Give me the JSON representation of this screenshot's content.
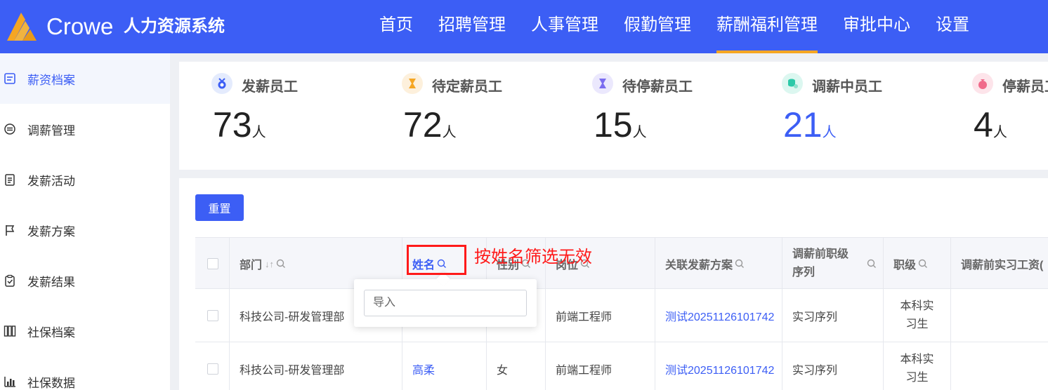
{
  "header": {
    "brand": "Crowe",
    "system_name": "人力资源系统",
    "nav": [
      {
        "label": "首页"
      },
      {
        "label": "招聘管理"
      },
      {
        "label": "人事管理"
      },
      {
        "label": "假勤管理"
      },
      {
        "label": "薪酬福利管理",
        "active": true
      },
      {
        "label": "审批中心"
      },
      {
        "label": "设置"
      }
    ],
    "accent_color": "#f5a623",
    "bg_color": "#3c5ef5"
  },
  "sidebar": {
    "items": [
      {
        "label": "薪资档案",
        "icon": "file-icon",
        "active": true
      },
      {
        "label": "调薪管理",
        "icon": "exchange-icon"
      },
      {
        "label": "发薪活动",
        "icon": "clipboard-icon"
      },
      {
        "label": "发薪方案",
        "icon": "flag-icon"
      },
      {
        "label": "发薪结果",
        "icon": "check-clipboard-icon"
      },
      {
        "label": "社保档案",
        "icon": "archive-icon"
      },
      {
        "label": "社保数据",
        "icon": "bar-chart-icon"
      }
    ]
  },
  "stats": [
    {
      "label": "发薪员工",
      "value": "73",
      "unit": "人",
      "icon": "medal-icon",
      "icon_color": "#3c5ef5"
    },
    {
      "label": "待定薪员工",
      "value": "72",
      "unit": "人",
      "icon": "hourglass-icon",
      "icon_color": "#f5a623"
    },
    {
      "label": "待停薪员工",
      "value": "15",
      "unit": "人",
      "icon": "hourglass-icon",
      "icon_color": "#7b6cf0"
    },
    {
      "label": "调薪中员工",
      "value": "21",
      "unit": "人",
      "icon": "coins-icon",
      "icon_color": "#2cc9a8",
      "highlight": "#3c5ef5"
    },
    {
      "label": "停薪员工",
      "value": "4",
      "unit": "人",
      "icon": "moneybag-icon",
      "icon_color": "#f06a8a"
    }
  ],
  "toolbar": {
    "reset_label": "重置"
  },
  "table": {
    "columns": [
      {
        "label": "部门"
      },
      {
        "label": "姓名"
      },
      {
        "label": "性别"
      },
      {
        "label": "岗位"
      },
      {
        "label": "关联发薪方案"
      },
      {
        "label": "调薪前职级序列"
      },
      {
        "label": "职级"
      },
      {
        "label": "调薪前实习工资("
      }
    ],
    "rows": [
      {
        "dept": "科技公司-研发管理部",
        "name": "",
        "gender": "",
        "position": "前端工程师",
        "plan": "测试20251126101742",
        "seq": "实习序列",
        "grade": "本科实习生",
        "salary": ""
      },
      {
        "dept": "科技公司-研发管理部",
        "name": "高柔",
        "gender": "女",
        "position": "前端工程师",
        "plan": "测试20251126101742",
        "seq": "实习序列",
        "grade": "本科实习生",
        "salary": ""
      }
    ]
  },
  "filter_popover": {
    "placeholder": "导入",
    "value": ""
  },
  "annotation": {
    "text": "按姓名筛选无效",
    "color": "#ff1a1a"
  }
}
